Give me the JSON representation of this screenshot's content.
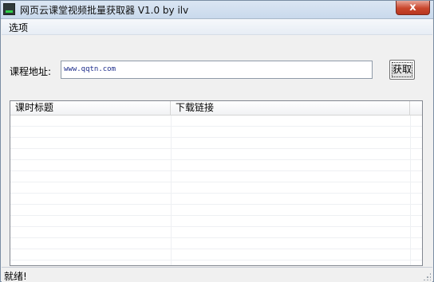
{
  "window": {
    "title": "网页云课堂视频批量获取器 V1.0 by ilv",
    "close_label": "x",
    "icon": "app-icon"
  },
  "menu": {
    "items": [
      {
        "label": "选项"
      }
    ]
  },
  "form": {
    "course_label": "课程地址:",
    "course_value": "www.qqtn.com",
    "fetch_label": "获取"
  },
  "list": {
    "columns": [
      {
        "label": "课时标题"
      },
      {
        "label": "下载链接"
      }
    ],
    "rows": []
  },
  "status": {
    "text": "就绪!"
  }
}
